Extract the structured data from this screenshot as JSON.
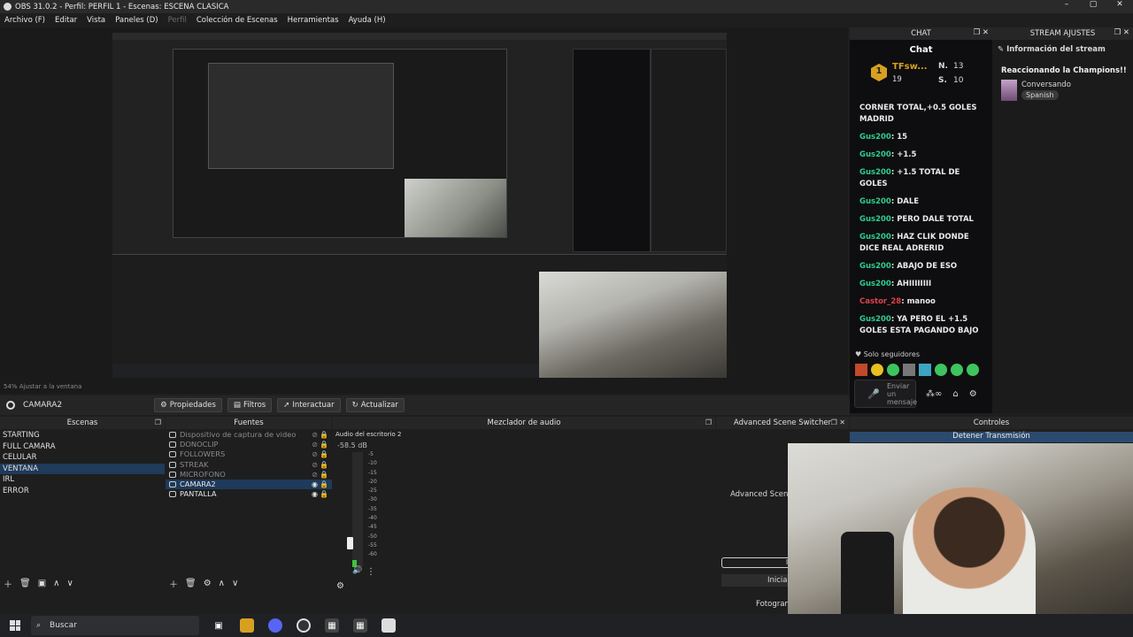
{
  "window": {
    "title": "OBS 31.0.2 - Perfil: PERFIL 1 - Escenas: ESCENA CLASICA",
    "controls": [
      "–",
      "▢",
      "✕"
    ]
  },
  "menu": {
    "items": [
      "Archivo (F)",
      "Editar",
      "Vista",
      "Paneles (D)",
      "Perfil",
      "Colección de Escenas",
      "Herramientas",
      "Ayuda (H)"
    ]
  },
  "zoom": {
    "label": "54% Ajustar a la ventana"
  },
  "source_bar": {
    "source_name": "CAMARA2",
    "properties": "Propiedades",
    "filters": "Filtros",
    "interact": "Interactuar",
    "refresh": "Actualizar"
  },
  "scenes": {
    "title": "Escenas",
    "items": [
      "STARTING",
      "FULL CAMARA",
      "CELULAR",
      "VENTANA",
      "IRL",
      "ERROR"
    ],
    "selected": "VENTANA"
  },
  "sources": {
    "title": "Fuentes",
    "items": [
      {
        "name": "Dispositivo de captura de video",
        "visible": false
      },
      {
        "name": "DONOCLIP",
        "visible": false
      },
      {
        "name": "FOLLOWERS",
        "visible": false
      },
      {
        "name": "STREAK",
        "visible": false
      },
      {
        "name": "MICROFONO",
        "visible": false
      },
      {
        "name": "CAMARA2",
        "visible": true,
        "selected": true
      },
      {
        "name": "PANTALLA",
        "visible": true
      }
    ]
  },
  "mixer": {
    "title": "Mezclador de audio",
    "channel": "Audio del escritorio 2",
    "db": "-58.5 dB",
    "ticks": [
      "-5",
      "-10",
      "-15",
      "-20",
      "-25",
      "-30",
      "-35",
      "-40",
      "-45",
      "-50",
      "-55",
      "-60"
    ],
    "level": 0.06
  },
  "switcher": {
    "title": "Advanced Scene Switcher",
    "label": "Advanced Scene S",
    "status": "Inacti",
    "start": "Iniciar"
  },
  "controls": {
    "title": "Controles",
    "stop": "Detener Transmisión",
    "fotogram": "Fotogram"
  },
  "chat": {
    "dock_title": "CHAT",
    "header": "Chat",
    "leader": {
      "name": "TFsw...",
      "rank": "1",
      "sub": "19",
      "n_label": "N.",
      "n_val": "13",
      "s_label": "S.",
      "s_val": "10"
    },
    "messages": [
      {
        "user": "",
        "text": "CORNER TOTAL,+0.5 GOLES MADRID"
      },
      {
        "user": "Gus200",
        "text": ": 15"
      },
      {
        "user": "Gus200",
        "text": ": +1.5"
      },
      {
        "user": "Gus200",
        "text": ": +1.5 TOTAL DE GOLES"
      },
      {
        "user": "Gus200",
        "text": ": DALE"
      },
      {
        "user": "Gus200",
        "text": ": PERO DALE TOTAL"
      },
      {
        "user": "Gus200",
        "text": ": HAZ CLIK DONDE DICE REAL ADRERID"
      },
      {
        "user": "Gus200",
        "text": ": ABAJO DE ESO"
      },
      {
        "user": "Gus200",
        "text": ": AHIIIIIIII"
      },
      {
        "user": "Castor_28",
        "text": ": manoo",
        "red": true
      },
      {
        "user": "Gus200",
        "text": ": YA PERO EL +1.5 GOLES ESTA PAGANDO BAJO"
      }
    ],
    "followers_only": "Solo seguidores",
    "send_placeholder": "Enviar un mensaje"
  },
  "stream": {
    "dock_title": "STREAM AJUSTES",
    "info_title": "Información del stream",
    "stream_title": "Reaccionando la Champions!!",
    "category": "Conversando",
    "language": "Spanish"
  },
  "taskbar": {
    "search": "Buscar"
  },
  "colors": {
    "accent": "#1f3a5a",
    "chat_user": "#2ecc8f",
    "chat_user_alt": "#e0404a",
    "bg": "#1e1e1e"
  }
}
